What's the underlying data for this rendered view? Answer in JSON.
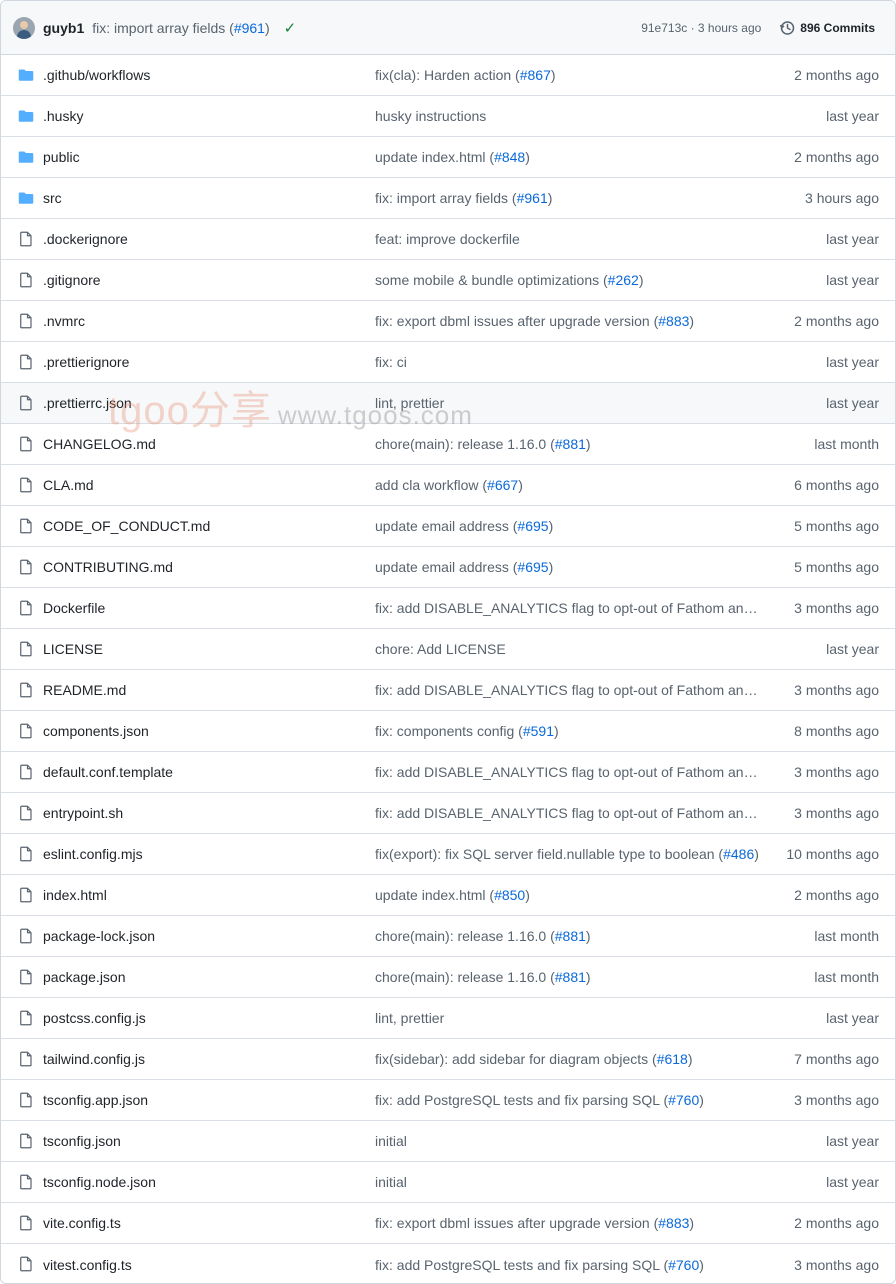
{
  "header": {
    "author": "guyb1",
    "message": "fix: import array fields (",
    "message_link": "#961",
    "message_suffix": ")",
    "sha_time": "91e713c · 3 hours ago",
    "commits_label": "896 Commits"
  },
  "watermark": {
    "brand": "tgoo分享",
    "url": "www.tgoos.com"
  },
  "files": [
    {
      "type": "folder",
      "name": ".github/workflows",
      "msg": "fix(cla): Harden action (",
      "link": "#867",
      "suffix": ")",
      "date": "2 months ago"
    },
    {
      "type": "folder",
      "name": ".husky",
      "msg": "husky instructions",
      "link": "",
      "suffix": "",
      "date": "last year"
    },
    {
      "type": "folder",
      "name": "public",
      "msg": "update index.html (",
      "link": "#848",
      "suffix": ")",
      "date": "2 months ago"
    },
    {
      "type": "folder",
      "name": "src",
      "msg": "fix: import array fields (",
      "link": "#961",
      "suffix": ")",
      "date": "3 hours ago"
    },
    {
      "type": "file",
      "name": ".dockerignore",
      "msg": "feat: improve dockerfile",
      "link": "",
      "suffix": "",
      "date": "last year"
    },
    {
      "type": "file",
      "name": ".gitignore",
      "msg": "some mobile & bundle optimizations (",
      "link": "#262",
      "suffix": ")",
      "date": "last year"
    },
    {
      "type": "file",
      "name": ".nvmrc",
      "msg": "fix: export dbml issues after upgrade version (",
      "link": "#883",
      "suffix": ")",
      "date": "2 months ago"
    },
    {
      "type": "file",
      "name": ".prettierignore",
      "msg": "fix: ci",
      "link": "",
      "suffix": "",
      "date": "last year"
    },
    {
      "type": "file",
      "name": ".prettierrc.json",
      "msg": "lint, prettier",
      "link": "",
      "suffix": "",
      "date": "last year"
    },
    {
      "type": "file",
      "name": "CHANGELOG.md",
      "msg": "chore(main): release 1.16.0 (",
      "link": "#881",
      "suffix": ")",
      "date": "last month"
    },
    {
      "type": "file",
      "name": "CLA.md",
      "msg": "add cla workflow (",
      "link": "#667",
      "suffix": ")",
      "date": "6 months ago"
    },
    {
      "type": "file",
      "name": "CODE_OF_CONDUCT.md",
      "msg": "update email address (",
      "link": "#695",
      "suffix": ")",
      "date": "5 months ago"
    },
    {
      "type": "file",
      "name": "CONTRIBUTING.md",
      "msg": "update email address (",
      "link": "#695",
      "suffix": ")",
      "date": "5 months ago"
    },
    {
      "type": "file",
      "name": "Dockerfile",
      "msg": "fix: add DISABLE_ANALYTICS flag to opt-out of Fathom analy...",
      "link": "",
      "suffix": "",
      "date": "3 months ago"
    },
    {
      "type": "file",
      "name": "LICENSE",
      "msg": "chore: Add LICENSE",
      "link": "",
      "suffix": "",
      "date": "last year"
    },
    {
      "type": "file",
      "name": "README.md",
      "msg": "fix: add DISABLE_ANALYTICS flag to opt-out of Fathom analy...",
      "link": "",
      "suffix": "",
      "date": "3 months ago"
    },
    {
      "type": "file",
      "name": "components.json",
      "msg": "fix: components config (",
      "link": "#591",
      "suffix": ")",
      "date": "8 months ago"
    },
    {
      "type": "file",
      "name": "default.conf.template",
      "msg": "fix: add DISABLE_ANALYTICS flag to opt-out of Fathom analy...",
      "link": "",
      "suffix": "",
      "date": "3 months ago"
    },
    {
      "type": "file",
      "name": "entrypoint.sh",
      "msg": "fix: add DISABLE_ANALYTICS flag to opt-out of Fathom analy...",
      "link": "",
      "suffix": "",
      "date": "3 months ago"
    },
    {
      "type": "file",
      "name": "eslint.config.mjs",
      "msg": "fix(export): fix SQL server field.nullable type to boolean (",
      "link": "#486",
      "suffix": ")",
      "date": "10 months ago"
    },
    {
      "type": "file",
      "name": "index.html",
      "msg": "update index.html (",
      "link": "#850",
      "suffix": ")",
      "date": "2 months ago"
    },
    {
      "type": "file",
      "name": "package-lock.json",
      "msg": "chore(main): release 1.16.0 (",
      "link": "#881",
      "suffix": ")",
      "date": "last month"
    },
    {
      "type": "file",
      "name": "package.json",
      "msg": "chore(main): release 1.16.0 (",
      "link": "#881",
      "suffix": ")",
      "date": "last month"
    },
    {
      "type": "file",
      "name": "postcss.config.js",
      "msg": "lint, prettier",
      "link": "",
      "suffix": "",
      "date": "last year"
    },
    {
      "type": "file",
      "name": "tailwind.config.js",
      "msg": "fix(sidebar): add sidebar for diagram objects (",
      "link": "#618",
      "suffix": ")",
      "date": "7 months ago"
    },
    {
      "type": "file",
      "name": "tsconfig.app.json",
      "msg": "fix: add PostgreSQL tests and fix parsing SQL (",
      "link": "#760",
      "suffix": ")",
      "date": "3 months ago"
    },
    {
      "type": "file",
      "name": "tsconfig.json",
      "msg": "initial",
      "link": "",
      "suffix": "",
      "date": "last year"
    },
    {
      "type": "file",
      "name": "tsconfig.node.json",
      "msg": "initial",
      "link": "",
      "suffix": "",
      "date": "last year"
    },
    {
      "type": "file",
      "name": "vite.config.ts",
      "msg": "fix: export dbml issues after upgrade version (",
      "link": "#883",
      "suffix": ")",
      "date": "2 months ago"
    },
    {
      "type": "file",
      "name": "vitest.config.ts",
      "msg": "fix: add PostgreSQL tests and fix parsing SQL (",
      "link": "#760",
      "suffix": ")",
      "date": "3 months ago"
    }
  ],
  "hover_index": 8,
  "colors": {
    "folder": "#54aeff",
    "link": "#0969da",
    "file_icon": "#59636e",
    "check": "#1a7f37"
  }
}
